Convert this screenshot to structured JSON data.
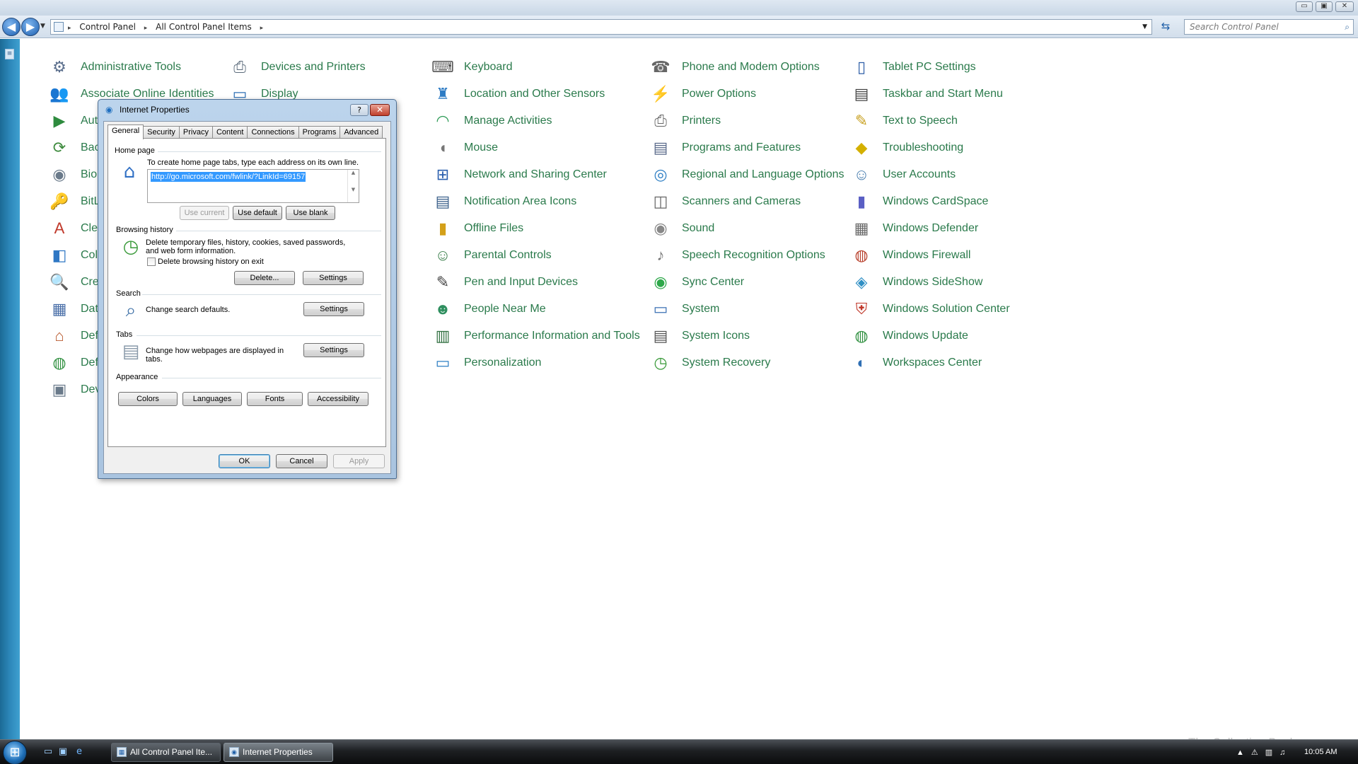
{
  "window": {
    "min_label": "▭",
    "max_label": "▣",
    "close_label": "✕"
  },
  "address": {
    "breadcrumbs": [
      "Control Panel",
      "All Control Panel Items"
    ],
    "search_placeholder": "Search Control Panel"
  },
  "items": [
    {
      "label": "Administrative Tools",
      "icon": "admin-tools-icon",
      "glyph": "⚙",
      "color": "#5a6e8c"
    },
    {
      "label": "Associate Online Identities",
      "icon": "online-identities-icon",
      "glyph": "👥",
      "color": "#3f6fa8"
    },
    {
      "label": "AutoPlay",
      "display": "AutoPl",
      "icon": "autoplay-icon",
      "glyph": "▶",
      "color": "#2e8b3e"
    },
    {
      "label": "Backup and Restore",
      "display": "Backup",
      "icon": "backup-icon",
      "glyph": "⟳",
      "color": "#3d8a3d"
    },
    {
      "label": "Biometric Devices",
      "display": "Biome",
      "icon": "biometric-icon",
      "glyph": "◉",
      "color": "#6a7a8a"
    },
    {
      "label": "BitLocker Drive Encryption",
      "display": "BitLoc",
      "icon": "bitlocker-icon",
      "glyph": "🔑",
      "color": "#7a7a7a"
    },
    {
      "label": "ClearType Text Tuner",
      "display": "ClearT",
      "icon": "cleartype-icon",
      "glyph": "A",
      "color": "#c0392b"
    },
    {
      "label": "Color Management",
      "display": "Color",
      "icon": "color-management-icon",
      "glyph": "◧",
      "color": "#2f77c4"
    },
    {
      "label": "Credential Manager",
      "display": "Creden",
      "icon": "credential-manager-icon",
      "glyph": "🔍",
      "color": "#c58b12"
    },
    {
      "label": "Date and Time",
      "display": "Date a",
      "icon": "date-time-icon",
      "glyph": "▦",
      "color": "#4a6fa8"
    },
    {
      "label": "Default Location",
      "display": "Defaul",
      "icon": "default-location-icon",
      "glyph": "⌂",
      "color": "#b8582c"
    },
    {
      "label": "Default Programs",
      "display": "Defaul",
      "icon": "default-programs-icon",
      "glyph": "◍",
      "color": "#2f8f3f"
    },
    {
      "label": "Device Manager",
      "display": "Device",
      "icon": "device-manager-icon",
      "glyph": "▣",
      "color": "#6a7a8a"
    },
    {
      "label": "Devices and Printers",
      "icon": "devices-printers-icon",
      "glyph": "⎙",
      "color": "#5a6a7a"
    },
    {
      "label": "Display",
      "icon": "display-icon",
      "glyph": "▭",
      "color": "#2f6fb4"
    },
    {
      "label": "Keyboard",
      "icon": "keyboard-icon",
      "glyph": "⌨",
      "color": "#555"
    },
    {
      "label": "Location and Other Sensors",
      "icon": "location-sensors-icon",
      "glyph": "♜",
      "color": "#2d7bc4"
    },
    {
      "label": "Manage Activities",
      "icon": "manage-activities-icon",
      "glyph": "◠",
      "color": "#2e9b57"
    },
    {
      "label": "Mouse",
      "icon": "mouse-icon",
      "glyph": "◖",
      "color": "#777"
    },
    {
      "label": "Network and Sharing Center",
      "icon": "network-sharing-icon",
      "glyph": "⊞",
      "color": "#2a5fae"
    },
    {
      "label": "Notification Area Icons",
      "icon": "notification-area-icon",
      "glyph": "▤",
      "color": "#3a5f8a"
    },
    {
      "label": "Offline Files",
      "icon": "offline-files-icon",
      "glyph": "▮",
      "color": "#d4a019"
    },
    {
      "label": "Parental Controls",
      "icon": "parental-controls-icon",
      "glyph": "☺",
      "color": "#3a7f4a"
    },
    {
      "label": "Pen and Input Devices",
      "icon": "pen-input-icon",
      "glyph": "✎",
      "color": "#444"
    },
    {
      "label": "People Near Me",
      "icon": "people-near-me-icon",
      "glyph": "☻",
      "color": "#2f8f5f"
    },
    {
      "label": "Performance Information and Tools",
      "icon": "performance-icon",
      "glyph": "▥",
      "color": "#2f6f3f"
    },
    {
      "label": "Personalization",
      "icon": "personalization-icon",
      "glyph": "▭",
      "color": "#2f7fc4"
    },
    {
      "label": "Phone and Modem Options",
      "icon": "phone-modem-icon",
      "glyph": "☎",
      "color": "#666"
    },
    {
      "label": "Power Options",
      "icon": "power-options-icon",
      "glyph": "⚡",
      "color": "#3a9a3a"
    },
    {
      "label": "Printers",
      "icon": "printers-icon",
      "glyph": "⎙",
      "color": "#666"
    },
    {
      "label": "Programs and Features",
      "icon": "programs-features-icon",
      "glyph": "▤",
      "color": "#5a6a8a"
    },
    {
      "label": "Regional and Language Options",
      "icon": "regional-language-icon",
      "glyph": "◎",
      "color": "#2f7fc4"
    },
    {
      "label": "Scanners and Cameras",
      "icon": "scanners-cameras-icon",
      "glyph": "◫",
      "color": "#666"
    },
    {
      "label": "Sound",
      "icon": "sound-icon",
      "glyph": "◉",
      "color": "#888"
    },
    {
      "label": "Speech Recognition Options",
      "icon": "speech-recognition-icon",
      "glyph": "♪",
      "color": "#777"
    },
    {
      "label": "Sync Center",
      "icon": "sync-center-icon",
      "glyph": "◉",
      "color": "#2ea84a"
    },
    {
      "label": "System",
      "icon": "system-icon",
      "glyph": "▭",
      "color": "#3a6fb4"
    },
    {
      "label": "System Icons",
      "icon": "system-icons-icon",
      "glyph": "▤",
      "color": "#555"
    },
    {
      "label": "System Recovery",
      "icon": "system-recovery-icon",
      "glyph": "◷",
      "color": "#3a9a3a"
    },
    {
      "label": "Tablet PC Settings",
      "icon": "tablet-pc-icon",
      "glyph": "▯",
      "color": "#2f5fa8"
    },
    {
      "label": "Taskbar and Start Menu",
      "icon": "taskbar-start-icon",
      "glyph": "▤",
      "color": "#444"
    },
    {
      "label": "Text to Speech",
      "icon": "text-to-speech-icon",
      "glyph": "✎",
      "color": "#c8a020"
    },
    {
      "label": "Troubleshooting",
      "icon": "troubleshooting-icon",
      "glyph": "◆",
      "color": "#d4b000"
    },
    {
      "label": "User Accounts",
      "icon": "user-accounts-icon",
      "glyph": "☺",
      "color": "#4a7fb0"
    },
    {
      "label": "Windows CardSpace",
      "icon": "cardspace-icon",
      "glyph": "▮",
      "color": "#5a5fc4"
    },
    {
      "label": "Windows Defender",
      "icon": "defender-icon",
      "glyph": "▦",
      "color": "#6a6a6a"
    },
    {
      "label": "Windows Firewall",
      "icon": "firewall-icon",
      "glyph": "◍",
      "color": "#b8402c"
    },
    {
      "label": "Windows SideShow",
      "icon": "sideshow-icon",
      "glyph": "◈",
      "color": "#2f8fc4"
    },
    {
      "label": "Windows Solution Center",
      "icon": "solution-center-icon",
      "glyph": "⛨",
      "color": "#c0392b"
    },
    {
      "label": "Windows Update",
      "icon": "windows-update-icon",
      "glyph": "◍",
      "color": "#2f8f3f"
    },
    {
      "label": "Workspaces Center",
      "icon": "workspaces-center-icon",
      "glyph": "◐",
      "color": "#2f6fb4"
    }
  ],
  "dialog": {
    "title": "Internet Properties",
    "help_label": "?",
    "close_label": "✕",
    "tabs": [
      "General",
      "Security",
      "Privacy",
      "Content",
      "Connections",
      "Programs",
      "Advanced"
    ],
    "active_tab": "General",
    "home_page": {
      "group_label": "Home page",
      "hint": "To create home page tabs, type each address on its own line.",
      "url": "http://go.microsoft.com/fwlink/?LinkId=69157",
      "use_current": "Use current",
      "use_default": "Use default",
      "use_blank": "Use blank"
    },
    "browsing_history": {
      "group_label": "Browsing history",
      "desc_line1": "Delete temporary files, history, cookies, saved passwords,",
      "desc_line2": "and web form information.",
      "checkbox_label": "Delete browsing history on exit",
      "checkbox_checked": false,
      "delete_label": "Delete...",
      "settings_label": "Settings"
    },
    "search": {
      "group_label": "Search",
      "desc": "Change search defaults.",
      "settings_label": "Settings"
    },
    "tabs_group": {
      "group_label": "Tabs",
      "desc_line1": "Change how webpages are displayed in",
      "desc_line2": "tabs.",
      "settings_label": "Settings"
    },
    "appearance": {
      "group_label": "Appearance",
      "colors": "Colors",
      "languages": "Languages",
      "fonts": "Fonts",
      "accessibility": "Accessibility"
    },
    "ok": "OK",
    "cancel": "Cancel",
    "apply": "Apply"
  },
  "taskbar": {
    "buttons": [
      {
        "label": "All Control Panel Ite...",
        "active": false
      },
      {
        "label": "Internet Properties",
        "active": true
      }
    ],
    "clock": "10:05 AM"
  },
  "watermark": "The Collection Book"
}
